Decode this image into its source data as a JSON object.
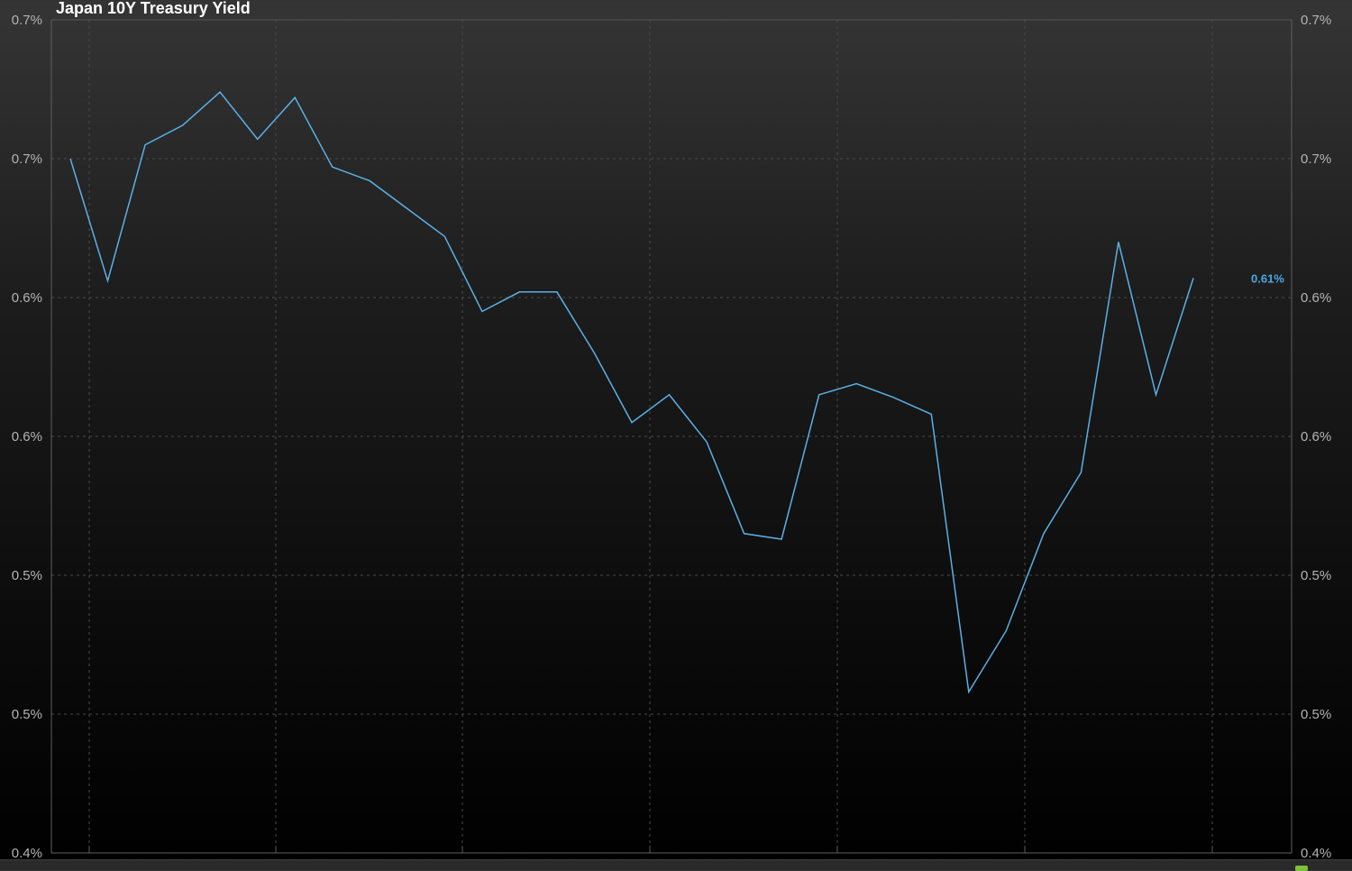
{
  "chart_data": {
    "type": "line",
    "title": "Japan 10Y Treasury Yield",
    "xlabel": "",
    "ylabel": "",
    "ylim": [
      0.4,
      0.7
    ],
    "y_tick_labels": [
      "0.7%",
      "0.7%",
      "0.6%",
      "0.6%",
      "0.5%",
      "0.5%",
      "0.4%"
    ],
    "grid": true,
    "series": [
      {
        "color": "#5ab0e8",
        "values": [
          0.65,
          0.606,
          0.655,
          0.662,
          0.674,
          0.657,
          0.672,
          0.647,
          0.642,
          0.632,
          0.622,
          0.595,
          0.602,
          0.602,
          0.58,
          0.555,
          0.565,
          0.548,
          0.515,
          0.513,
          0.565,
          0.569,
          0.564,
          0.558,
          0.458,
          0.48,
          0.515,
          0.537,
          0.62,
          0.565,
          0.607
        ]
      }
    ],
    "last_value_label": "0.61%"
  }
}
